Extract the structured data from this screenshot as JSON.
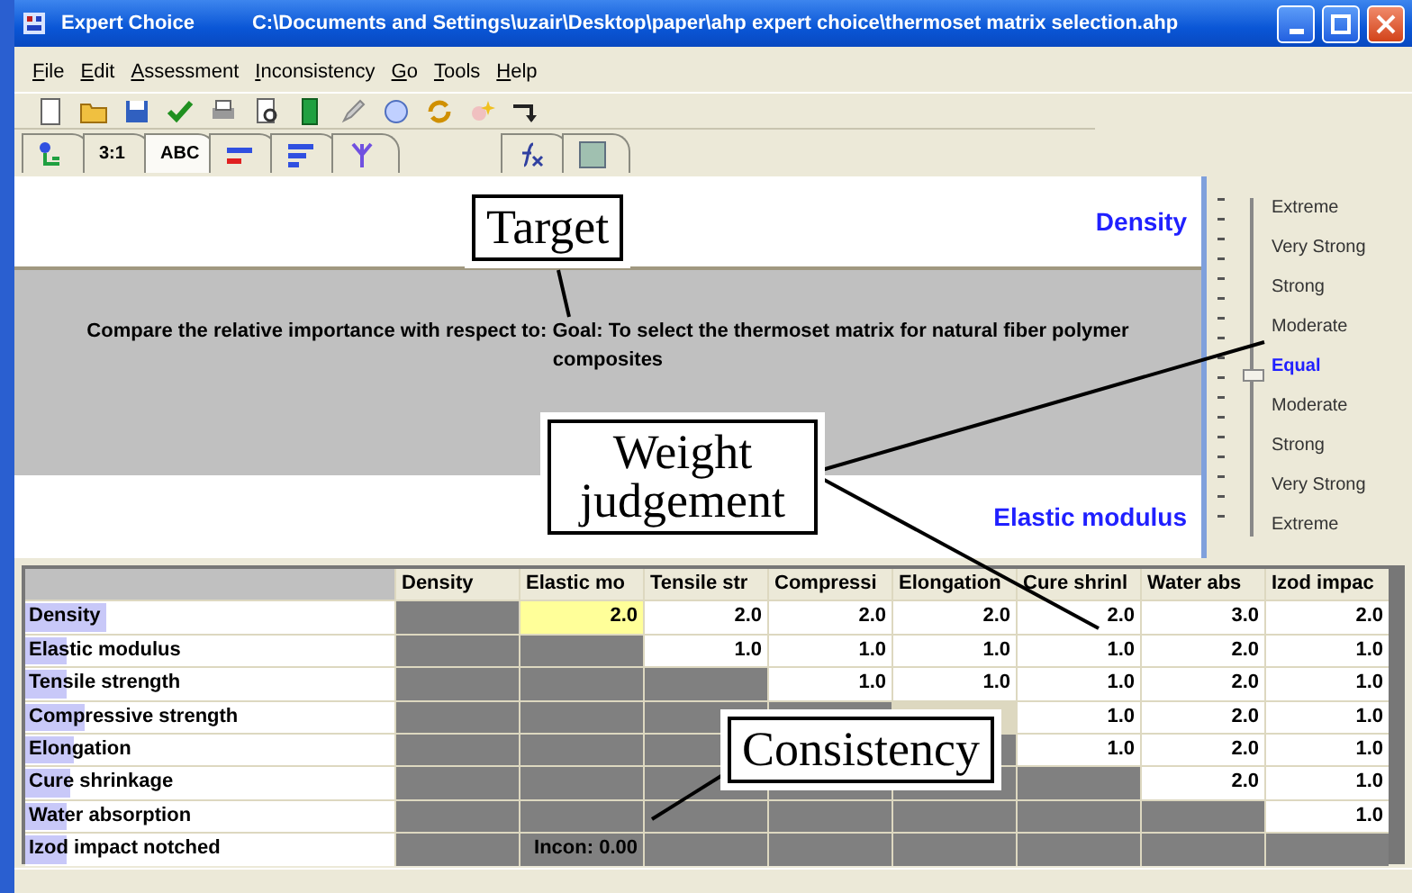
{
  "window": {
    "app": "Expert Choice",
    "path": "C:\\Documents and Settings\\uzair\\Desktop\\paper\\ahp expert choice\\thermoset matrix selection.ahp"
  },
  "menu": [
    "File",
    "Edit",
    "Assessment",
    "Inconsistency",
    "Go",
    "Tools",
    "Help"
  ],
  "tabs": [
    {
      "kind": "tree",
      "selected": false
    },
    {
      "kind": "text",
      "label": "3:1",
      "selected": false
    },
    {
      "kind": "text",
      "label": "ABC",
      "selected": true
    },
    {
      "kind": "bars",
      "selected": false
    },
    {
      "kind": "lines",
      "selected": false
    },
    {
      "kind": "fork",
      "selected": false
    },
    {
      "kind": "gap"
    },
    {
      "kind": "fx",
      "selected": false
    },
    {
      "kind": "grid",
      "selected": false
    }
  ],
  "comparison": {
    "top": "Density",
    "prompt": "Compare the relative importance with respect to: Goal: To select the thermoset matrix for natural fiber polymer composites",
    "bottom": "Elastic modulus"
  },
  "scale": [
    {
      "label": "Extreme",
      "selected": false
    },
    {
      "label": "Very Strong",
      "selected": false
    },
    {
      "label": "Strong",
      "selected": false
    },
    {
      "label": "Moderate",
      "selected": false
    },
    {
      "label": "Equal",
      "selected": true
    },
    {
      "label": "Moderate",
      "selected": false
    },
    {
      "label": "Strong",
      "selected": false
    },
    {
      "label": "Very Strong",
      "selected": false
    },
    {
      "label": "Extreme",
      "selected": false
    }
  ],
  "matrix": {
    "columns": [
      "Density",
      "Elastic mo",
      "Tensile str",
      "Compressi",
      "Elongation",
      "Cure shrinl",
      "Water abs",
      "Izod impac"
    ],
    "rows": [
      {
        "name": "Density",
        "level": 0.22,
        "cells": [
          {
            "kind": "shaded"
          },
          {
            "kind": "value",
            "text": "2.0",
            "selected": true
          },
          {
            "kind": "value",
            "text": "2.0",
            "selected": false
          },
          {
            "kind": "value",
            "text": "2.0",
            "selected": false
          },
          {
            "kind": "value",
            "text": "2.0",
            "selected": false
          },
          {
            "kind": "value",
            "text": "2.0",
            "selected": false
          },
          {
            "kind": "value",
            "text": "3.0",
            "selected": false
          },
          {
            "kind": "value",
            "text": "2.0",
            "selected": false
          }
        ]
      },
      {
        "name": "Elastic modulus",
        "level": 0.11,
        "cells": [
          {
            "kind": "shaded"
          },
          {
            "kind": "shaded"
          },
          {
            "kind": "value",
            "text": "1.0",
            "selected": false
          },
          {
            "kind": "value",
            "text": "1.0",
            "selected": false
          },
          {
            "kind": "value",
            "text": "1.0",
            "selected": false
          },
          {
            "kind": "value",
            "text": "1.0",
            "selected": false
          },
          {
            "kind": "value",
            "text": "2.0",
            "selected": false
          },
          {
            "kind": "value",
            "text": "1.0",
            "selected": false
          }
        ]
      },
      {
        "name": "Tensile strength",
        "level": 0.11,
        "cells": [
          {
            "kind": "shaded"
          },
          {
            "kind": "shaded"
          },
          {
            "kind": "shaded"
          },
          {
            "kind": "value",
            "text": "1.0",
            "selected": false
          },
          {
            "kind": "value",
            "text": "1.0",
            "selected": false
          },
          {
            "kind": "value",
            "text": "1.0",
            "selected": false
          },
          {
            "kind": "value",
            "text": "2.0",
            "selected": false
          },
          {
            "kind": "value",
            "text": "1.0",
            "selected": false
          }
        ]
      },
      {
        "name": "Compressive strength",
        "level": 0.16,
        "cells": [
          {
            "kind": "shaded"
          },
          {
            "kind": "shaded"
          },
          {
            "kind": "shaded"
          },
          {
            "kind": "shaded"
          },
          {
            "kind": "value"
          },
          {
            "kind": "value",
            "text": "1.0",
            "selected": false
          },
          {
            "kind": "value",
            "text": "2.0",
            "selected": false
          },
          {
            "kind": "value",
            "text": "1.0",
            "selected": false
          }
        ]
      },
      {
        "name": "Elongation",
        "level": 0.13,
        "cells": [
          {
            "kind": "shaded"
          },
          {
            "kind": "shaded"
          },
          {
            "kind": "shaded"
          },
          {
            "kind": "covered"
          },
          {
            "kind": "shaded"
          },
          {
            "kind": "value",
            "text": "1.0",
            "selected": false
          },
          {
            "kind": "value",
            "text": "2.0",
            "selected": false
          },
          {
            "kind": "value",
            "text": "1.0",
            "selected": false
          }
        ]
      },
      {
        "name": "Cure shrinkage",
        "level": 0.12,
        "cells": [
          {
            "kind": "shaded"
          },
          {
            "kind": "shaded"
          },
          {
            "kind": "shaded"
          },
          {
            "kind": "shaded"
          },
          {
            "kind": "shaded"
          },
          {
            "kind": "shaded"
          },
          {
            "kind": "value",
            "text": "2.0",
            "selected": false
          },
          {
            "kind": "value",
            "text": "1.0",
            "selected": false
          }
        ]
      },
      {
        "name": "Water absorption",
        "level": 0.11,
        "cells": [
          {
            "kind": "shaded"
          },
          {
            "kind": "shaded"
          },
          {
            "kind": "shaded"
          },
          {
            "kind": "shaded"
          },
          {
            "kind": "shaded"
          },
          {
            "kind": "shaded"
          },
          {
            "kind": "shaded"
          },
          {
            "kind": "value",
            "text": "1.0",
            "selected": false
          }
        ]
      },
      {
        "name": "Izod impact notched",
        "level": 0.11,
        "cells": [
          {
            "kind": "shaded"
          },
          {
            "kind": "shaded",
            "text": "Incon: 0.00"
          },
          {
            "kind": "shaded"
          },
          {
            "kind": "shaded"
          },
          {
            "kind": "shaded"
          },
          {
            "kind": "shaded"
          },
          {
            "kind": "shaded"
          },
          {
            "kind": "shaded"
          }
        ]
      }
    ]
  },
  "callouts": [
    {
      "text": "Target"
    },
    {
      "text": "Weight judgement"
    },
    {
      "text": "Consistency"
    }
  ]
}
